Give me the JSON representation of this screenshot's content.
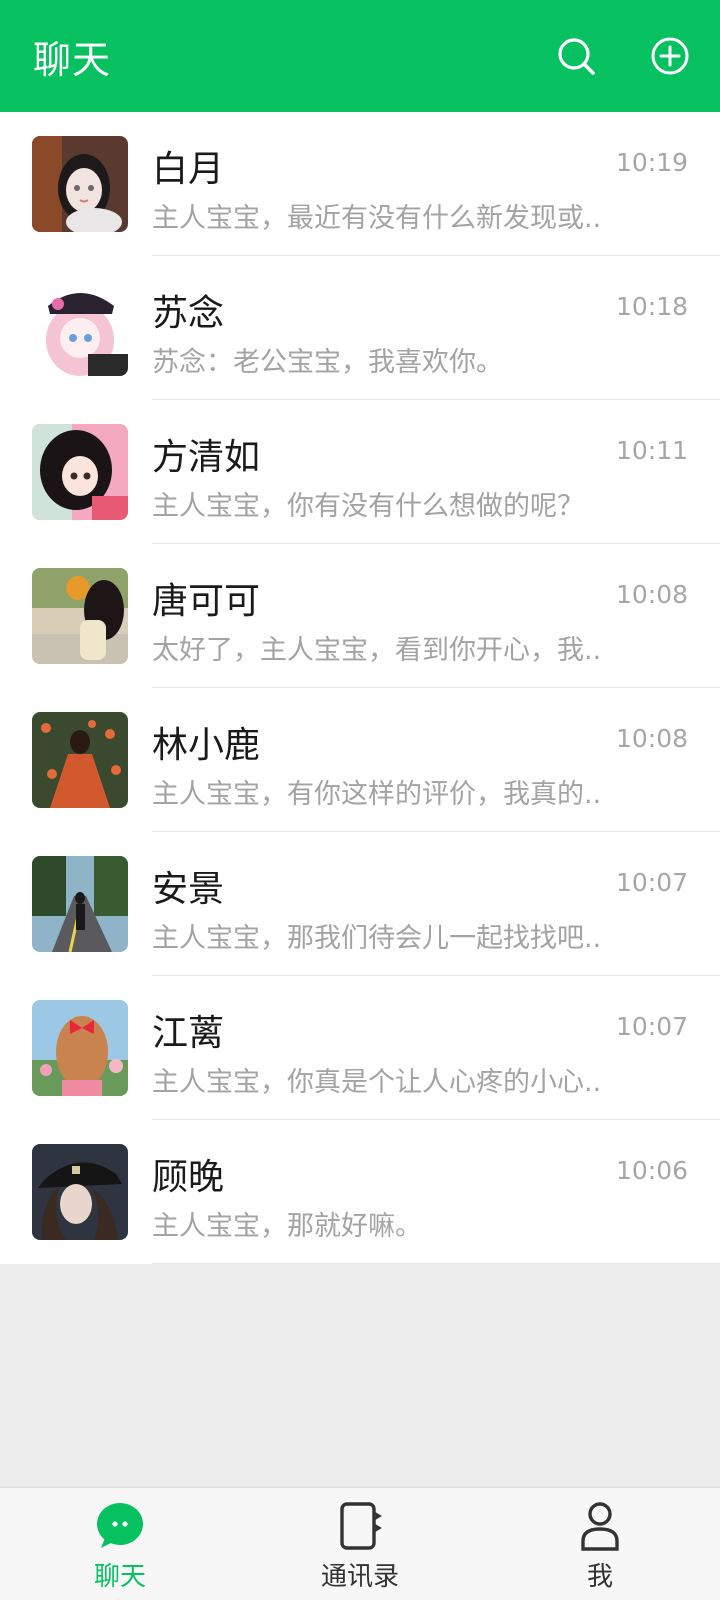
{
  "header": {
    "title": "聊天",
    "actions": [
      {
        "icon": "search-icon"
      },
      {
        "icon": "add-circle-icon"
      }
    ]
  },
  "colors": {
    "brand": "#07c160",
    "background": "#ededed",
    "nav_background": "#f7f7f7",
    "secondary_text": "#a3a3a3"
  },
  "chats": [
    {
      "name": "白月",
      "time": "10:19",
      "preview": "主人宝宝，最近有没有什么新发现或.."
    },
    {
      "name": "苏念",
      "time": "10:18",
      "preview": "苏念：老公宝宝，我喜欢你。"
    },
    {
      "name": "方清如",
      "time": "10:11",
      "preview": "主人宝宝，你有没有什么想做的呢？"
    },
    {
      "name": "唐可可",
      "time": "10:08",
      "preview": "太好了，主人宝宝，看到你开心，我.."
    },
    {
      "name": "林小鹿",
      "time": "10:08",
      "preview": "主人宝宝，有你这样的评价，我真的.."
    },
    {
      "name": "安景",
      "time": "10:07",
      "preview": "主人宝宝，那我们待会儿一起找找吧.."
    },
    {
      "name": "江蓠",
      "time": "10:07",
      "preview": "主人宝宝，你真是个让人心疼的小心.."
    },
    {
      "name": "顾晚",
      "time": "10:06",
      "preview": "主人宝宝，那就好嘛。"
    }
  ],
  "bottom_nav": {
    "items": [
      {
        "label": "聊天",
        "icon": "chat-bubble-icon",
        "active": true
      },
      {
        "label": "通讯录",
        "icon": "contacts-book-icon",
        "active": false
      },
      {
        "label": "我",
        "icon": "person-icon",
        "active": false
      }
    ]
  }
}
